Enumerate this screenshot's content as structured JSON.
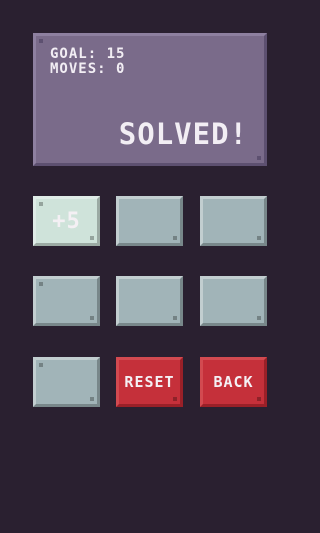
{
  "display": {
    "goal": "GOAL: 15",
    "moves": "MOVES: 0",
    "status": "SOLVED!"
  },
  "buttons": {
    "plus5": "+5",
    "reset": "RESET",
    "back": "BACK"
  },
  "colors": {
    "background": "#2a2030",
    "display": "#7a6b8a",
    "tile": "#a1b4b8",
    "tile_active": "#cfe3da",
    "danger": "#c5303a"
  }
}
